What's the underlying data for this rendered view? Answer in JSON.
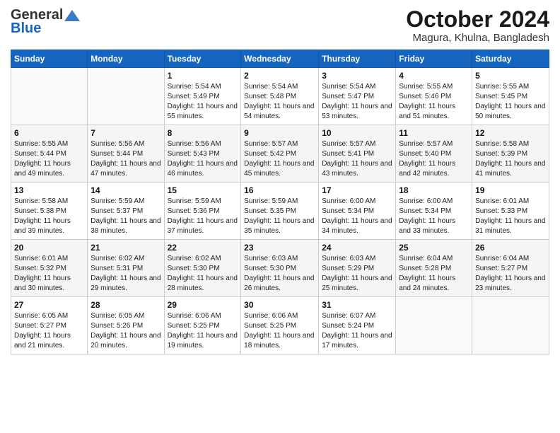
{
  "header": {
    "logo_general": "General",
    "logo_blue": "Blue",
    "month": "October 2024",
    "location": "Magura, Khulna, Bangladesh"
  },
  "days_of_week": [
    "Sunday",
    "Monday",
    "Tuesday",
    "Wednesday",
    "Thursday",
    "Friday",
    "Saturday"
  ],
  "weeks": [
    [
      {
        "day": "",
        "info": ""
      },
      {
        "day": "",
        "info": ""
      },
      {
        "day": "1",
        "sunrise": "Sunrise: 5:54 AM",
        "sunset": "Sunset: 5:49 PM",
        "daylight": "Daylight: 11 hours and 55 minutes."
      },
      {
        "day": "2",
        "sunrise": "Sunrise: 5:54 AM",
        "sunset": "Sunset: 5:48 PM",
        "daylight": "Daylight: 11 hours and 54 minutes."
      },
      {
        "day": "3",
        "sunrise": "Sunrise: 5:54 AM",
        "sunset": "Sunset: 5:47 PM",
        "daylight": "Daylight: 11 hours and 53 minutes."
      },
      {
        "day": "4",
        "sunrise": "Sunrise: 5:55 AM",
        "sunset": "Sunset: 5:46 PM",
        "daylight": "Daylight: 11 hours and 51 minutes."
      },
      {
        "day": "5",
        "sunrise": "Sunrise: 5:55 AM",
        "sunset": "Sunset: 5:45 PM",
        "daylight": "Daylight: 11 hours and 50 minutes."
      }
    ],
    [
      {
        "day": "6",
        "sunrise": "Sunrise: 5:55 AM",
        "sunset": "Sunset: 5:44 PM",
        "daylight": "Daylight: 11 hours and 49 minutes."
      },
      {
        "day": "7",
        "sunrise": "Sunrise: 5:56 AM",
        "sunset": "Sunset: 5:44 PM",
        "daylight": "Daylight: 11 hours and 47 minutes."
      },
      {
        "day": "8",
        "sunrise": "Sunrise: 5:56 AM",
        "sunset": "Sunset: 5:43 PM",
        "daylight": "Daylight: 11 hours and 46 minutes."
      },
      {
        "day": "9",
        "sunrise": "Sunrise: 5:57 AM",
        "sunset": "Sunset: 5:42 PM",
        "daylight": "Daylight: 11 hours and 45 minutes."
      },
      {
        "day": "10",
        "sunrise": "Sunrise: 5:57 AM",
        "sunset": "Sunset: 5:41 PM",
        "daylight": "Daylight: 11 hours and 43 minutes."
      },
      {
        "day": "11",
        "sunrise": "Sunrise: 5:57 AM",
        "sunset": "Sunset: 5:40 PM",
        "daylight": "Daylight: 11 hours and 42 minutes."
      },
      {
        "day": "12",
        "sunrise": "Sunrise: 5:58 AM",
        "sunset": "Sunset: 5:39 PM",
        "daylight": "Daylight: 11 hours and 41 minutes."
      }
    ],
    [
      {
        "day": "13",
        "sunrise": "Sunrise: 5:58 AM",
        "sunset": "Sunset: 5:38 PM",
        "daylight": "Daylight: 11 hours and 39 minutes."
      },
      {
        "day": "14",
        "sunrise": "Sunrise: 5:59 AM",
        "sunset": "Sunset: 5:37 PM",
        "daylight": "Daylight: 11 hours and 38 minutes."
      },
      {
        "day": "15",
        "sunrise": "Sunrise: 5:59 AM",
        "sunset": "Sunset: 5:36 PM",
        "daylight": "Daylight: 11 hours and 37 minutes."
      },
      {
        "day": "16",
        "sunrise": "Sunrise: 5:59 AM",
        "sunset": "Sunset: 5:35 PM",
        "daylight": "Daylight: 11 hours and 35 minutes."
      },
      {
        "day": "17",
        "sunrise": "Sunrise: 6:00 AM",
        "sunset": "Sunset: 5:34 PM",
        "daylight": "Daylight: 11 hours and 34 minutes."
      },
      {
        "day": "18",
        "sunrise": "Sunrise: 6:00 AM",
        "sunset": "Sunset: 5:34 PM",
        "daylight": "Daylight: 11 hours and 33 minutes."
      },
      {
        "day": "19",
        "sunrise": "Sunrise: 6:01 AM",
        "sunset": "Sunset: 5:33 PM",
        "daylight": "Daylight: 11 hours and 31 minutes."
      }
    ],
    [
      {
        "day": "20",
        "sunrise": "Sunrise: 6:01 AM",
        "sunset": "Sunset: 5:32 PM",
        "daylight": "Daylight: 11 hours and 30 minutes."
      },
      {
        "day": "21",
        "sunrise": "Sunrise: 6:02 AM",
        "sunset": "Sunset: 5:31 PM",
        "daylight": "Daylight: 11 hours and 29 minutes."
      },
      {
        "day": "22",
        "sunrise": "Sunrise: 6:02 AM",
        "sunset": "Sunset: 5:30 PM",
        "daylight": "Daylight: 11 hours and 28 minutes."
      },
      {
        "day": "23",
        "sunrise": "Sunrise: 6:03 AM",
        "sunset": "Sunset: 5:30 PM",
        "daylight": "Daylight: 11 hours and 26 minutes."
      },
      {
        "day": "24",
        "sunrise": "Sunrise: 6:03 AM",
        "sunset": "Sunset: 5:29 PM",
        "daylight": "Daylight: 11 hours and 25 minutes."
      },
      {
        "day": "25",
        "sunrise": "Sunrise: 6:04 AM",
        "sunset": "Sunset: 5:28 PM",
        "daylight": "Daylight: 11 hours and 24 minutes."
      },
      {
        "day": "26",
        "sunrise": "Sunrise: 6:04 AM",
        "sunset": "Sunset: 5:27 PM",
        "daylight": "Daylight: 11 hours and 23 minutes."
      }
    ],
    [
      {
        "day": "27",
        "sunrise": "Sunrise: 6:05 AM",
        "sunset": "Sunset: 5:27 PM",
        "daylight": "Daylight: 11 hours and 21 minutes."
      },
      {
        "day": "28",
        "sunrise": "Sunrise: 6:05 AM",
        "sunset": "Sunset: 5:26 PM",
        "daylight": "Daylight: 11 hours and 20 minutes."
      },
      {
        "day": "29",
        "sunrise": "Sunrise: 6:06 AM",
        "sunset": "Sunset: 5:25 PM",
        "daylight": "Daylight: 11 hours and 19 minutes."
      },
      {
        "day": "30",
        "sunrise": "Sunrise: 6:06 AM",
        "sunset": "Sunset: 5:25 PM",
        "daylight": "Daylight: 11 hours and 18 minutes."
      },
      {
        "day": "31",
        "sunrise": "Sunrise: 6:07 AM",
        "sunset": "Sunset: 5:24 PM",
        "daylight": "Daylight: 11 hours and 17 minutes."
      },
      {
        "day": "",
        "info": ""
      },
      {
        "day": "",
        "info": ""
      }
    ]
  ]
}
